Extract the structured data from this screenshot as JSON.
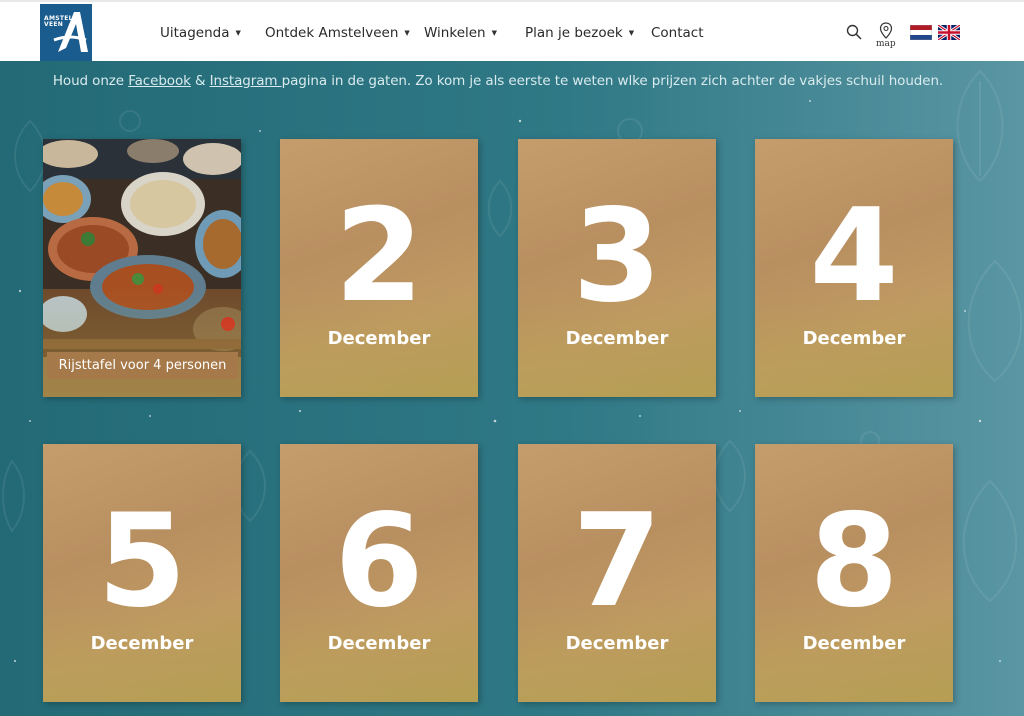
{
  "header": {
    "logo_text": [
      "AMSTEL",
      "VEEN"
    ],
    "nav": [
      {
        "label": "Uitagenda",
        "has_dropdown": true
      },
      {
        "label": "Ontdek Amstelveen",
        "has_dropdown": true
      },
      {
        "label": "Winkelen",
        "has_dropdown": true
      },
      {
        "label": "Plan je bezoek",
        "has_dropdown": true
      },
      {
        "label": "Contact",
        "has_dropdown": false
      }
    ],
    "map_label": "map",
    "icons": [
      "search-icon",
      "map-pin-icon",
      "flag-nl-icon",
      "flag-uk-icon"
    ]
  },
  "intro": {
    "before": "Houd onze ",
    "facebook": "Facebook",
    "amp": " & ",
    "instagram": "Instagram ",
    "after": "pagina in de gaten. Zo kom je als eerste te weten wlke prijzen zich achter de vakjes schuil houden."
  },
  "calendar": {
    "opened": {
      "label": "Rijsttafel voor 4 personen"
    },
    "tiles": [
      {
        "number": "2",
        "month": "December"
      },
      {
        "number": "3",
        "month": "December"
      },
      {
        "number": "4",
        "month": "December"
      },
      {
        "number": "5",
        "month": "December"
      },
      {
        "number": "6",
        "month": "December"
      },
      {
        "number": "7",
        "month": "December"
      },
      {
        "number": "8",
        "month": "December"
      }
    ]
  },
  "colors": {
    "background": "#2e7783",
    "tile": "#c09a68",
    "prize_label": "#a6794a",
    "logo": "#1b5c8e"
  }
}
